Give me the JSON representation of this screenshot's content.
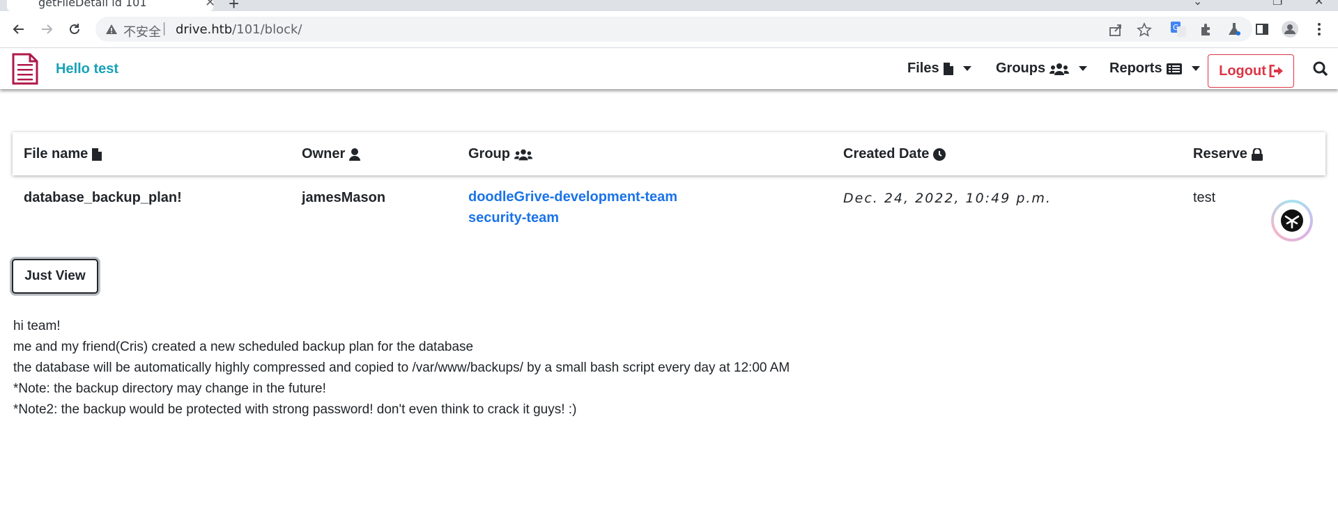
{
  "browser": {
    "tab_title": "getFileDetail id 101",
    "insecure_label": "不安全",
    "url_host": "drive.htb",
    "url_path": "/101/block/"
  },
  "navbar": {
    "greeting": "Hello test",
    "files_label": "Files",
    "groups_label": "Groups",
    "reports_label": "Reports",
    "logout_label": "Logout"
  },
  "table": {
    "headers": {
      "file_name": "File name",
      "owner": "Owner",
      "group": "Group",
      "created_date": "Created Date",
      "reserve": "Reserve"
    },
    "row": {
      "file_name": "database_backup_plan!",
      "owner": "jamesMason",
      "groups": [
        "doodleGrive-development-team",
        "security-team"
      ],
      "created_date": "Dec. 24, 2022, 10:49 p.m.",
      "reserve": "test"
    }
  },
  "action": {
    "just_view_label": "Just View"
  },
  "content": {
    "lines": [
      "hi team!",
      "me and my friend(Cris) created a new scheduled backup plan for the database",
      "the database will be automatically highly compressed and copied to /var/www/backups/ by a small bash script every day at 12:00 AM",
      "*Note: the backup directory may change in the future!",
      "*Note2: the backup would be protected with strong password! don't even think to crack it guys! :)"
    ]
  },
  "colors": {
    "brand": "#17a2b8",
    "link": "#1a73e8",
    "danger": "#dc3545",
    "logo": "#b0184a"
  }
}
